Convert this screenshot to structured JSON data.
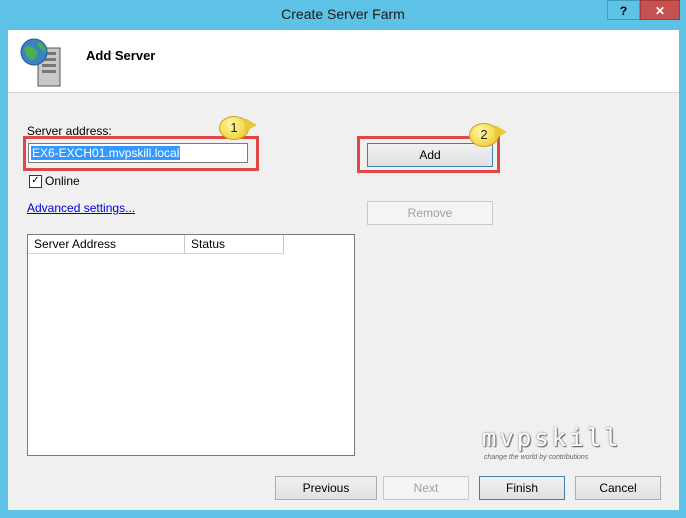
{
  "window": {
    "title": "Create Server Farm",
    "help_label": "?",
    "close_label": "✕"
  },
  "header": {
    "title": "Add Server",
    "icon": "server-globe-icon"
  },
  "form": {
    "server_address_label": "Server address:",
    "server_address_value": "EX6-EXCH01.mvpskill.local",
    "online_label": "Online",
    "online_checked": true,
    "advanced_link": "Advanced settings...",
    "add_label": "Add",
    "remove_label": "Remove"
  },
  "table": {
    "columns": [
      "Server Address",
      "Status"
    ],
    "rows": []
  },
  "callouts": {
    "step1": "1",
    "step2": "2"
  },
  "watermark": {
    "brand": "mvpskill",
    "tagline": "change the world by contributions"
  },
  "footer": {
    "previous_label": "Previous",
    "next_label": "Next",
    "finish_label": "Finish",
    "cancel_label": "Cancel"
  },
  "colors": {
    "titlebar": "#5ec2e6",
    "highlight_box": "#e04848",
    "selection": "#3399ff",
    "link": "#0000cc"
  }
}
